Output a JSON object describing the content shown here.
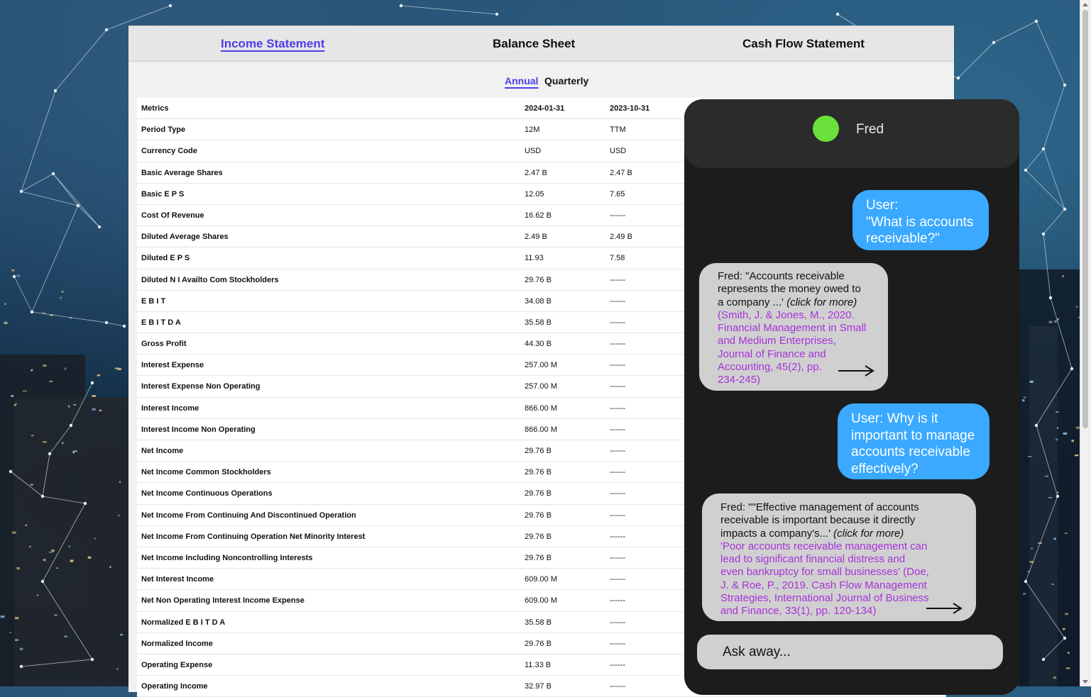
{
  "tabs": {
    "income": "Income Statement",
    "balance": "Balance Sheet",
    "cashflow": "Cash Flow Statement"
  },
  "periods": {
    "annual": "Annual",
    "quarterly": "Quarterly"
  },
  "table": {
    "headers": [
      "Metrics",
      "2024-01-31",
      "2023-10-31"
    ],
    "rows": [
      [
        "Period Type",
        "12M",
        "TTM"
      ],
      [
        "Currency Code",
        "USD",
        "USD"
      ],
      [
        "Basic Average Shares",
        "2.47 B",
        "2.47 B"
      ],
      [
        "Basic E P S",
        "12.05",
        "7.65"
      ],
      [
        "Cost Of Revenue",
        "16.62 B",
        "------"
      ],
      [
        "Diluted Average Shares",
        "2.49 B",
        "2.49 B"
      ],
      [
        "Diluted E P S",
        "11.93",
        "7.58"
      ],
      [
        "Diluted N I Availto Com Stockholders",
        "29.76 B",
        "------"
      ],
      [
        "E B I T",
        "34.08 B",
        "------"
      ],
      [
        "E B I T D A",
        "35.58 B",
        "------"
      ],
      [
        "Gross Profit",
        "44.30 B",
        "------"
      ],
      [
        "Interest Expense",
        "257.00 M",
        "------"
      ],
      [
        "Interest Expense Non Operating",
        "257.00 M",
        "------"
      ],
      [
        "Interest Income",
        "866.00 M",
        "------"
      ],
      [
        "Interest Income Non Operating",
        "866.00 M",
        "------"
      ],
      [
        "Net Income",
        "29.76 B",
        "------"
      ],
      [
        "Net Income Common Stockholders",
        "29.76 B",
        "------"
      ],
      [
        "Net Income Continuous Operations",
        "29.76 B",
        "------"
      ],
      [
        "Net Income From Continuing And Discontinued Operation",
        "29.76 B",
        "------"
      ],
      [
        "Net Income From Continuing Operation Net Minority Interest",
        "29.76 B",
        "------"
      ],
      [
        "Net Income Including Noncontrolling Interests",
        "29.76 B",
        "------"
      ],
      [
        "Net Interest Income",
        "609.00 M",
        "------"
      ],
      [
        "Net Non Operating Interest Income Expense",
        "609.00 M",
        "------"
      ],
      [
        "Normalized E B I T D A",
        "35.58 B",
        "------"
      ],
      [
        "Normalized Income",
        "29.76 B",
        "------"
      ],
      [
        "Operating Expense",
        "11.33 B",
        "------"
      ],
      [
        "Operating Income",
        "32.97 B",
        "------"
      ]
    ]
  },
  "chat": {
    "name": "Fred",
    "status_color": "#6be03a",
    "messages": [
      {
        "role": "user",
        "lines": [
          "User:",
          "\"What is accounts",
          "receivable?\""
        ]
      },
      {
        "role": "fred",
        "lines": [
          "Fred: \"Accounts receivable",
          "represents the money owed to",
          "a company ...'"
        ],
        "more": "(click for more)",
        "cite_lines": [
          "(Smith, J. & Jones, M., 2020.",
          "Financial Management in Small",
          "and Medium Enterprises,",
          "Journal of Finance and",
          "Accounting, 45(2), pp.",
          "234-245)"
        ]
      },
      {
        "role": "user",
        "lines": [
          "User: Why is it",
          "important to manage",
          "accounts receivable",
          "effectively?"
        ]
      },
      {
        "role": "fred",
        "lines": [
          "Fred: \"\"Effective management of accounts",
          "receivable is important because it directly",
          "impacts a company's...'"
        ],
        "more": "(click for more)",
        "cite_lines": [
          "'Poor accounts receivable management can",
          "lead to significant financial distress and",
          "even bankruptcy for small businesses' (Doe,",
          "J. & Roe, P., 2019. Cash Flow Management",
          "Strategies, International Journal of Business",
          "and Finance, 33(1), pp. 120-134)"
        ]
      }
    ],
    "input_placeholder": "Ask away..."
  },
  "colors": {
    "accent": "#4a3ee8",
    "user_bubble": "#3aa9ff",
    "fred_bubble": "#d0d0d0",
    "citation": "#a633d9",
    "chat_bg": "#1c1c1c"
  }
}
